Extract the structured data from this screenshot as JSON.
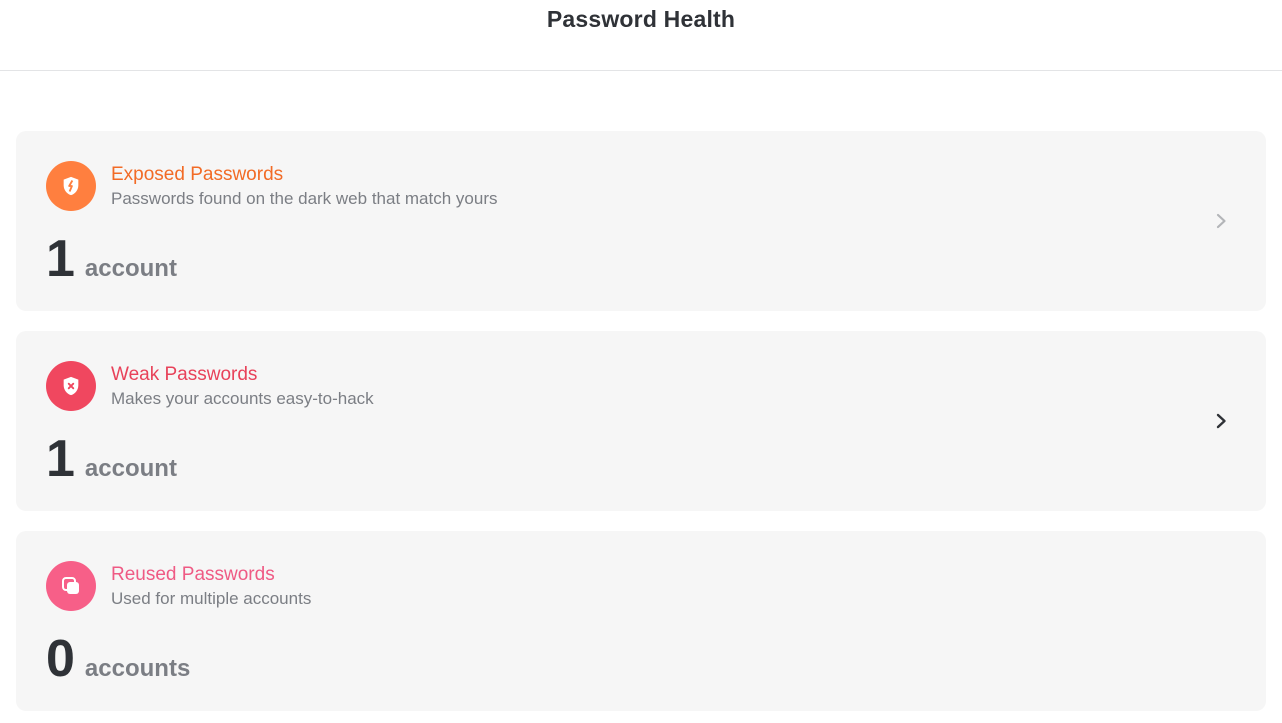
{
  "header": {
    "title": "Password Health"
  },
  "cards": [
    {
      "title": "Exposed Passwords",
      "subtitle": "Passwords found on the dark web that match yours",
      "count": "1",
      "unit": "account",
      "icon": "broken-shield-icon",
      "accent": "#f26b26",
      "icon_bg": "#ff7f3f"
    },
    {
      "title": "Weak Passwords",
      "subtitle": "Makes your accounts easy-to-hack",
      "count": "1",
      "unit": "account",
      "icon": "shield-x-icon",
      "accent": "#e8425a",
      "icon_bg": "#f0475f"
    },
    {
      "title": "Reused Passwords",
      "subtitle": "Used for multiple accounts",
      "count": "0",
      "unit": "accounts",
      "icon": "copy-icon",
      "accent": "#ef5a84",
      "icon_bg": "#f75f88"
    }
  ],
  "colors": {
    "card_bg": "#f6f6f6",
    "text_primary": "#2f3237",
    "text_secondary": "#7b7e84",
    "chevron_disabled": "#b3b5b8",
    "chevron_active": "#2f3237"
  }
}
